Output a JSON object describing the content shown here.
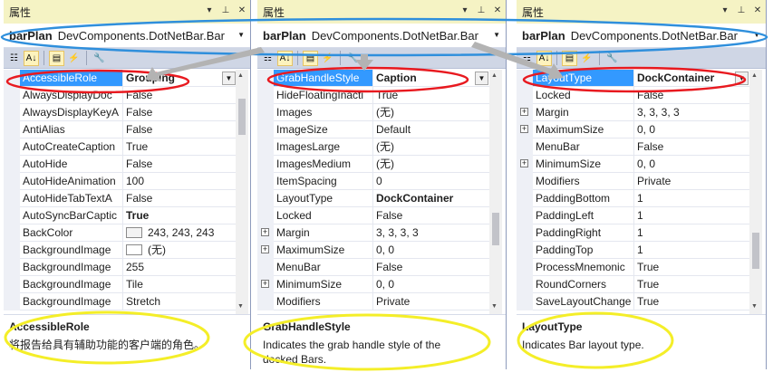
{
  "colors": {
    "selection": "#3399ff",
    "annotation_red": "#e8191f",
    "annotation_blue": "#2f8fdc",
    "annotation_yellow": "#f4ee28",
    "title_bg": "#f5f3c4"
  },
  "icons": [
    "categorized-icon",
    "alphabetical-icon",
    "property-pages-icon",
    "events-icon",
    "wrench-icon"
  ],
  "panels": [
    {
      "title": "属性",
      "object_name": "barPlan",
      "object_type": "DevComponents.DotNetBar.Bar",
      "rows": [
        {
          "name": "AccessibleRole",
          "value": "Grouping",
          "bold": true,
          "selected": true,
          "dropdown": true
        },
        {
          "name": "AlwaysDisplayDoc",
          "value": "False"
        },
        {
          "name": "AlwaysDisplayKeyA",
          "value": "False"
        },
        {
          "name": "AntiAlias",
          "value": "False"
        },
        {
          "name": "AutoCreateCaption",
          "value": "True"
        },
        {
          "name": "AutoHide",
          "value": "False"
        },
        {
          "name": "AutoHideAnimation",
          "value": "100"
        },
        {
          "name": "AutoHideTabTextA",
          "value": "False"
        },
        {
          "name": "AutoSyncBarCaptic",
          "value": "True",
          "bold": true
        },
        {
          "name": "BackColor",
          "value": "243, 243, 243",
          "swatch": "#f3f3f3"
        },
        {
          "name": "BackgroundImage",
          "value": "(无)",
          "swatch": "#ffffff"
        },
        {
          "name": "BackgroundImage",
          "value": "255"
        },
        {
          "name": "BackgroundImage",
          "value": "Tile"
        },
        {
          "name": "BackgroundImage",
          "value": "Stretch"
        }
      ],
      "desc_title": "AccessibleRole",
      "desc_text": "将报告给具有辅助功能的客户端的角色。"
    },
    {
      "title": "属性",
      "object_name": "barPlan",
      "object_type": "DevComponents.DotNetBar.Bar",
      "rows": [
        {
          "name": "GrabHandleStyle",
          "value": "Caption",
          "bold": true,
          "selected": true,
          "dropdown": true
        },
        {
          "name": "HideFloatingInacti",
          "value": "True"
        },
        {
          "name": "Images",
          "value": "(无)"
        },
        {
          "name": "ImageSize",
          "value": "Default"
        },
        {
          "name": "ImagesLarge",
          "value": "(无)"
        },
        {
          "name": "ImagesMedium",
          "value": "(无)"
        },
        {
          "name": "ItemSpacing",
          "value": "0"
        },
        {
          "name": "LayoutType",
          "value": "DockContainer",
          "bold": true
        },
        {
          "name": "Locked",
          "value": "False"
        },
        {
          "name": "Margin",
          "value": "3, 3, 3, 3",
          "expand": true
        },
        {
          "name": "MaximumSize",
          "value": "0, 0",
          "expand": true
        },
        {
          "name": "MenuBar",
          "value": "False"
        },
        {
          "name": "MinimumSize",
          "value": "0, 0",
          "expand": true
        },
        {
          "name": "Modifiers",
          "value": "Private"
        }
      ],
      "desc_title": "GrabHandleStyle",
      "desc_text": "Indicates the grab handle style of the docked Bars."
    },
    {
      "title": "属性",
      "object_name": "barPlan",
      "object_type": "DevComponents.DotNetBar.Bar",
      "rows": [
        {
          "name": "LayoutType",
          "value": "DockContainer",
          "bold": true,
          "selected": true,
          "dropdown": true
        },
        {
          "name": "Locked",
          "value": "False"
        },
        {
          "name": "Margin",
          "value": "3, 3, 3, 3",
          "expand": true
        },
        {
          "name": "MaximumSize",
          "value": "0, 0",
          "expand": true
        },
        {
          "name": "MenuBar",
          "value": "False"
        },
        {
          "name": "MinimumSize",
          "value": "0, 0",
          "expand": true
        },
        {
          "name": "Modifiers",
          "value": "Private"
        },
        {
          "name": "PaddingBottom",
          "value": "1"
        },
        {
          "name": "PaddingLeft",
          "value": "1"
        },
        {
          "name": "PaddingRight",
          "value": "1"
        },
        {
          "name": "PaddingTop",
          "value": "1"
        },
        {
          "name": "ProcessMnemonic",
          "value": "True"
        },
        {
          "name": "RoundCorners",
          "value": "True"
        },
        {
          "name": "SaveLayoutChange",
          "value": "True"
        }
      ],
      "desc_title": "LayoutType",
      "desc_text": "Indicates Bar layout type."
    }
  ]
}
